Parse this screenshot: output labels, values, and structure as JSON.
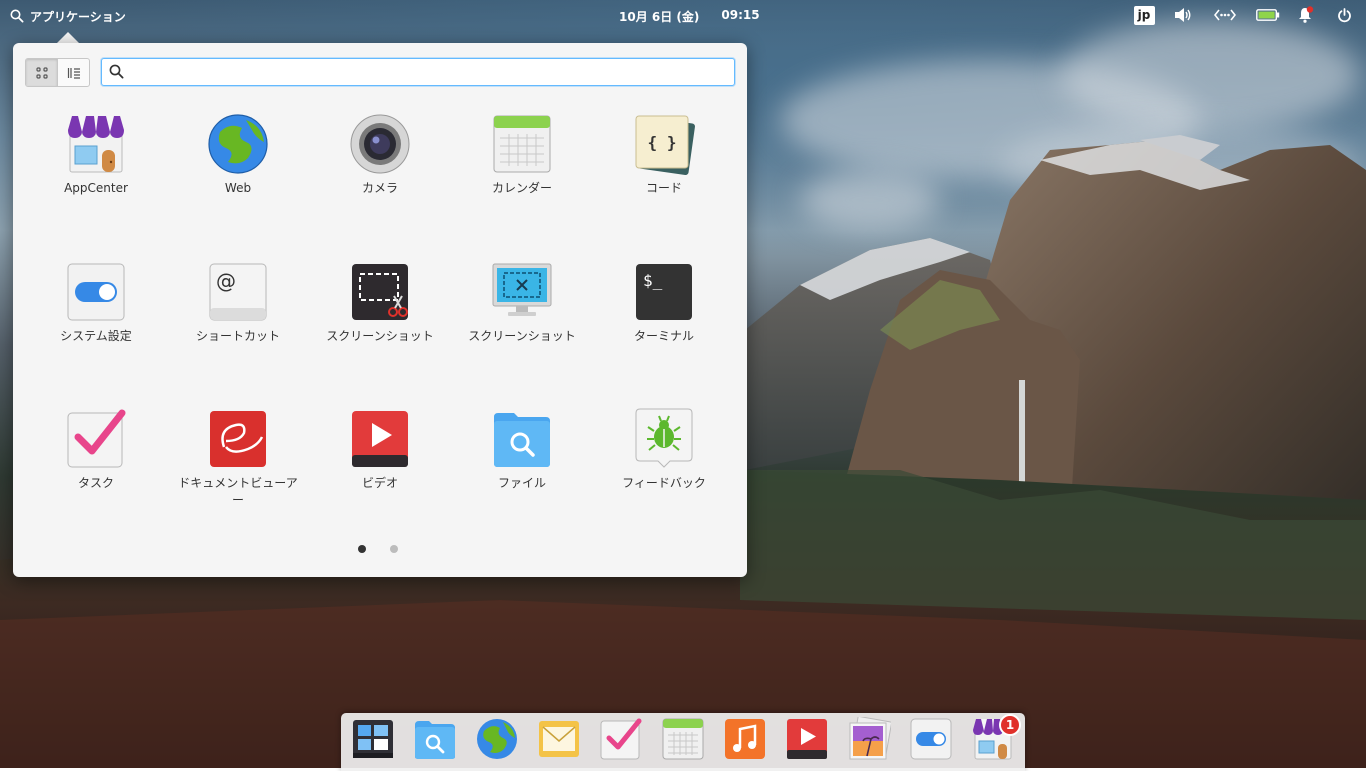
{
  "panel": {
    "applications_label": "アプリケーション",
    "date": "10月 6日 (金)",
    "time": "09:15",
    "keyboard_layout": "jp",
    "icons": [
      "volume-icon",
      "network-icon",
      "battery-icon",
      "notification-icon",
      "power-icon"
    ]
  },
  "launcher": {
    "search": {
      "value": "",
      "placeholder": ""
    },
    "views": [
      "grid-view",
      "category-view"
    ],
    "apps": [
      {
        "label": "AppCenter",
        "icon": "appcenter-icon"
      },
      {
        "label": "Web",
        "icon": "web-browser-icon"
      },
      {
        "label": "カメラ",
        "icon": "camera-icon"
      },
      {
        "label": "カレンダー",
        "icon": "calendar-icon"
      },
      {
        "label": "コード",
        "icon": "code-editor-icon"
      },
      {
        "label": "システム設定",
        "icon": "system-settings-icon"
      },
      {
        "label": "ショートカット",
        "icon": "shortcut-icon"
      },
      {
        "label": "スクリーンショット",
        "icon": "screenshot-icon"
      },
      {
        "label": "スクリーンショット",
        "icon": "screenshot-monitor-icon"
      },
      {
        "label": "ターミナル",
        "icon": "terminal-icon"
      },
      {
        "label": "タスク",
        "icon": "tasks-icon"
      },
      {
        "label": "ドキュメントビューアー",
        "icon": "document-viewer-icon"
      },
      {
        "label": "ビデオ",
        "icon": "videos-icon"
      },
      {
        "label": "ファイル",
        "icon": "files-icon"
      },
      {
        "label": "フィードバック",
        "icon": "feedback-icon"
      }
    ],
    "page_count": 2,
    "current_page": 1
  },
  "dock": {
    "items": [
      "multitasking-view-icon",
      "files-icon",
      "web-browser-icon",
      "mail-icon",
      "tasks-icon",
      "calendar-icon",
      "music-icon",
      "videos-icon",
      "photos-icon",
      "system-settings-icon",
      "appcenter-icon"
    ],
    "appcenter_badge": "1"
  },
  "colors": {
    "accent": "#64baff",
    "popover_bg": "#f5f5f5",
    "badge": "#e0312b"
  }
}
